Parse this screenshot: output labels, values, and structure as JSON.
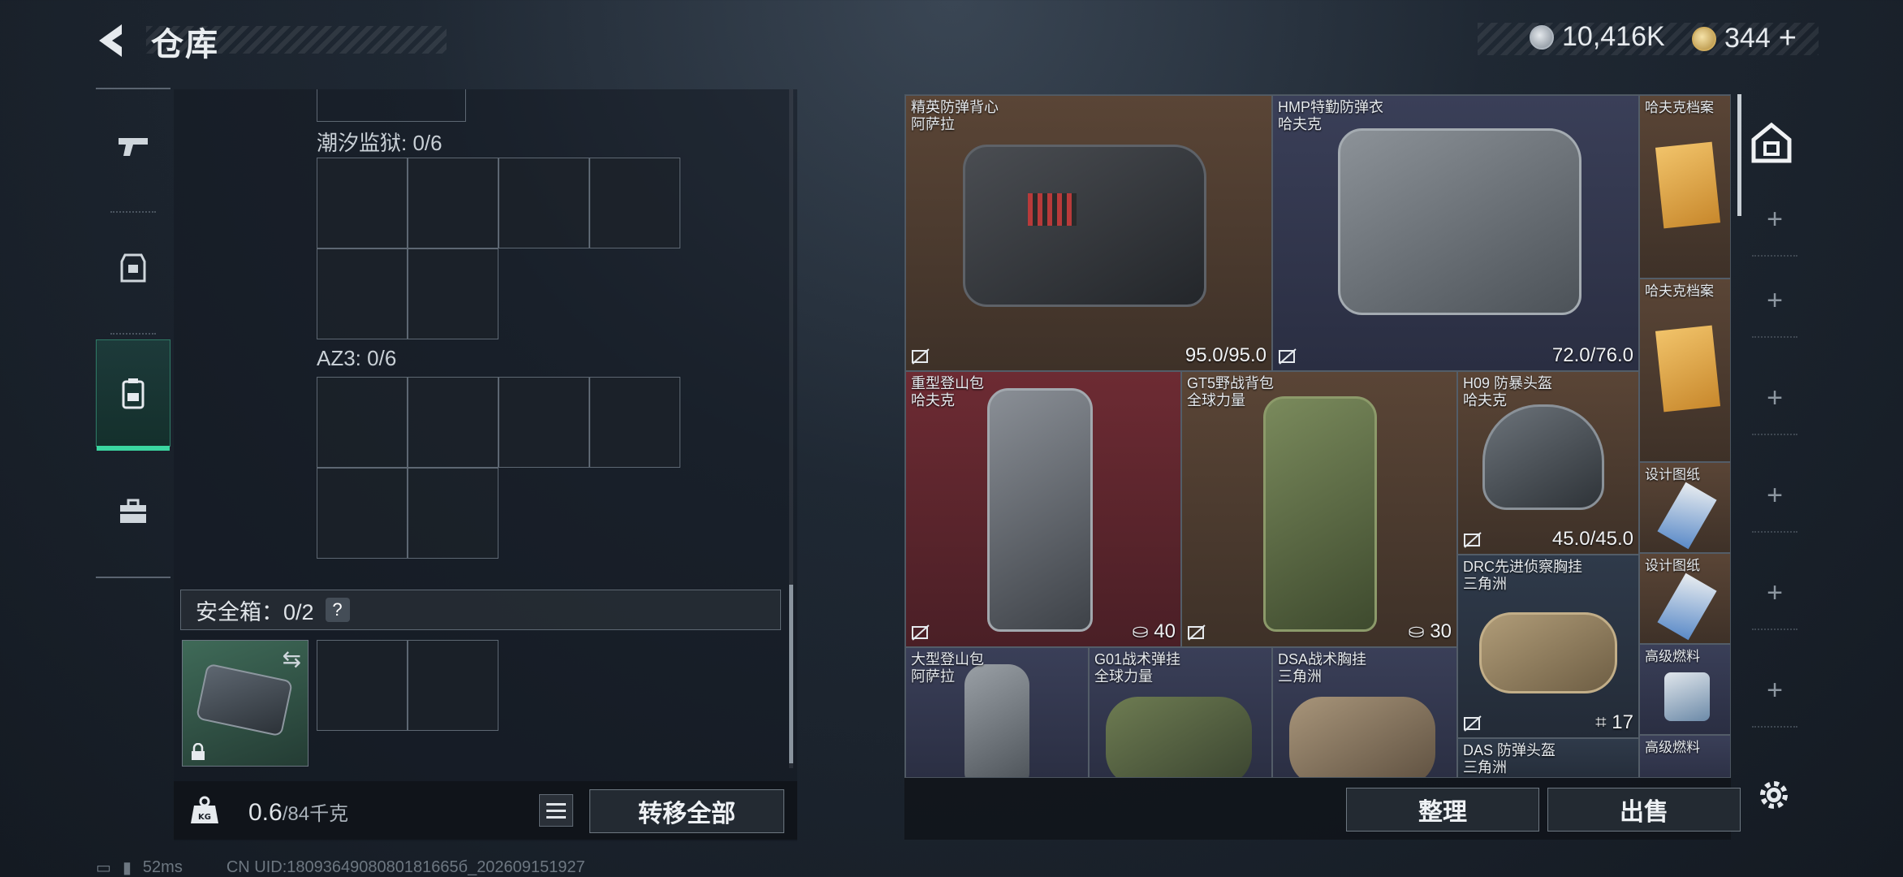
{
  "header": {
    "title": "仓库"
  },
  "currency": {
    "silver": "10,416K",
    "gold": "344",
    "plus": "+"
  },
  "left_rail": {
    "items": [
      "weapon",
      "armor",
      "backpack",
      "toolbox"
    ],
    "active": 2
  },
  "containers": [
    {
      "label": "潮汐监狱: 0/6"
    },
    {
      "label": "AZ3: 0/6"
    }
  ],
  "safe_box": {
    "label": "安全箱：0/2",
    "help": "?"
  },
  "weight": {
    "current": "0.6",
    "max": "/84千克"
  },
  "buttons": {
    "transfer_all": "转移全部",
    "sort": "整理",
    "sell": "出售"
  },
  "inventory": [
    {
      "name": "精英防弹背心",
      "brand": "阿萨拉",
      "value": "95.0/95.0"
    },
    {
      "name": "HMP特勤防弹衣",
      "brand": "哈夫克",
      "value": "72.0/76.0"
    },
    {
      "name": "哈夫克档案",
      "brand": "",
      "value": ""
    },
    {
      "name": "哈夫克档案",
      "brand": "",
      "value": ""
    },
    {
      "name": "重型登山包",
      "brand": "哈夫克",
      "value": "40"
    },
    {
      "name": "GT5野战背包",
      "brand": "全球力量",
      "value": "30"
    },
    {
      "name": "H09 防暴头盔",
      "brand": "哈夫克",
      "value": "45.0/45.0"
    },
    {
      "name": "设计图纸",
      "brand": "",
      "value": ""
    },
    {
      "name": "设计图纸",
      "brand": "",
      "value": ""
    },
    {
      "name": "DRC先进侦察胸挂",
      "brand": "三角洲",
      "value": "17"
    },
    {
      "name": "高级燃料",
      "brand": "",
      "value": ""
    },
    {
      "name": "大型登山包",
      "brand": "阿萨拉",
      "value": ""
    },
    {
      "name": "G01战术弹挂",
      "brand": "全球力量",
      "value": ""
    },
    {
      "name": "DSA战术胸挂",
      "brand": "三角洲",
      "value": ""
    },
    {
      "name": "DAS 防弹头盔",
      "brand": "三角洲",
      "value": ""
    },
    {
      "name": "高级燃料",
      "brand": "",
      "value": ""
    }
  ],
  "status": {
    "ping": "52ms",
    "uid": "CN UID:1809364908080181665б_202609151927"
  },
  "colors": {
    "accent": "#3bd6a0",
    "brown": "#5a4536",
    "red": "#6d2b33",
    "navy": "#3a3f58"
  }
}
